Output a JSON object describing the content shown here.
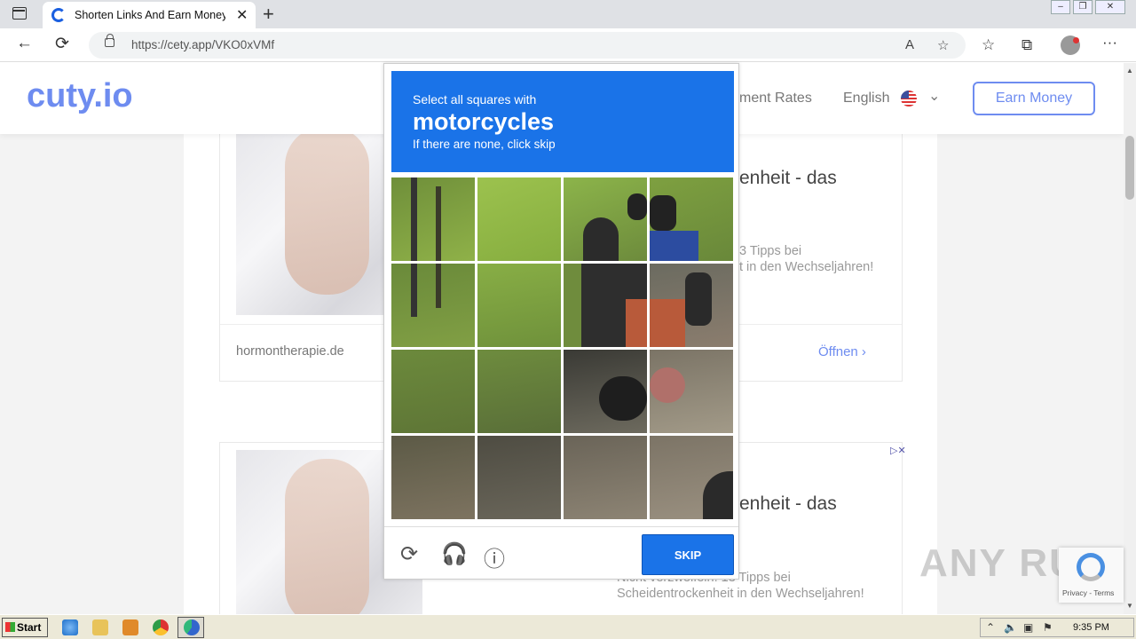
{
  "browser": {
    "tab_title": "Shorten Links And Earn Money | c",
    "tab_close": "✕",
    "new_tab": "+",
    "url": "https://cety.app/VKO0xVMf",
    "back": "←",
    "reload": "⟳",
    "read_aloud": "A",
    "favorites_add": "☆",
    "favorites": "☆",
    "collections": "⧉",
    "more": "···"
  },
  "site": {
    "logo": "cuty.io",
    "nav_partial": "ment Rates",
    "language": "English",
    "earn_button": "Earn Money"
  },
  "ads": [
    {
      "headline_partial": "enheit - das",
      "desc_line1": "3 Tipps bei",
      "desc_line2": "t in den Wechseljahren!",
      "domain": "hormontherapie.de",
      "open": "Öffnen ›"
    },
    {
      "headline_partial": "enheit - das",
      "desc_line1": "Nicht verzweifeln: 13 Tipps bei",
      "desc_line2": "Scheidentrockenheit in den Wechseljahren!"
    }
  ],
  "captcha": {
    "instruction": "Select all squares with",
    "object": "motorcycles",
    "hint": "If there are none, click skip",
    "skip_button": "SKIP",
    "colors": {
      "header": "#1a73e8"
    }
  },
  "recaptcha_badge": {
    "text": "Privacy - Terms"
  },
  "watermark": "ANY RUN",
  "taskbar": {
    "start": "Start",
    "clock": "9:35 PM"
  }
}
